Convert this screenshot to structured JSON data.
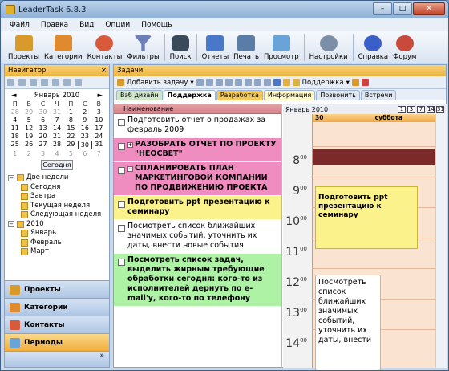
{
  "app": {
    "title": "LeaderTask 6.8.3"
  },
  "menu": [
    "Файл",
    "Правка",
    "Вид",
    "Опции",
    "Помощь"
  ],
  "toolbar": [
    {
      "label": "Проекты",
      "color": "#d89a2a"
    },
    {
      "label": "Категории",
      "color": "#e08a2f"
    },
    {
      "label": "Контакты",
      "color": "#d85a3a"
    },
    {
      "label": "Фильтры",
      "color": "#6d7fb8"
    },
    {
      "label": "Поиск",
      "color": "#3a4a5a"
    },
    {
      "label": "Отчеты",
      "color": "#4a78c8"
    },
    {
      "label": "Печать",
      "color": "#5a7da8"
    },
    {
      "label": "Просмотр",
      "color": "#6aa3d8"
    },
    {
      "label": "Настройки",
      "color": "#7d8fa8"
    },
    {
      "label": "Справка",
      "color": "#3a5fc8"
    },
    {
      "label": "Форум",
      "color": "#c84a3a"
    }
  ],
  "navigator": {
    "title": "Навигатор",
    "calendar": {
      "month": "Январь 2010",
      "weekdays": [
        "П",
        "В",
        "С",
        "Ч",
        "П",
        "С",
        "В"
      ],
      "days": [
        [
          "28",
          "29",
          "30",
          "31",
          "1",
          "2",
          "3"
        ],
        [
          "4",
          "5",
          "6",
          "7",
          "8",
          "9",
          "10"
        ],
        [
          "11",
          "12",
          "13",
          "14",
          "15",
          "16",
          "17"
        ],
        [
          "18",
          "19",
          "20",
          "21",
          "22",
          "23",
          "24"
        ],
        [
          "25",
          "26",
          "27",
          "28",
          "29",
          "30",
          "31"
        ],
        [
          "1",
          "2",
          "3",
          "4",
          "5",
          "6",
          "7"
        ]
      ],
      "today_label": "Сегодня"
    },
    "tree": {
      "g1": "Две недели",
      "g1items": [
        "Сегодня",
        "Завтра",
        "Текущая неделя",
        "Следующая неделя"
      ],
      "g2": "2010",
      "g2items": [
        "Январь",
        "Февраль",
        "Март"
      ]
    },
    "sections": [
      "Проекты",
      "Категории",
      "Контакты",
      "Периоды"
    ]
  },
  "tasks_panel": {
    "title": "Задачи",
    "add_label": "Добавить задачу",
    "podderzhka": "Поддержка",
    "tabs": [
      "Вэб дизайн",
      "Поддержка",
      "Разработка",
      "Информация",
      "Позвонить",
      "Встречи"
    ],
    "column_header": "Наименование",
    "rows": [
      {
        "text": "Подготовить отчет о продажах за февраль 2009",
        "style": "plain"
      },
      {
        "text": "РАЗОБРАТЬ ОТЧЕТ ПО ПРОЕКТУ \"НЕОСВЕТ\"",
        "style": "pink",
        "expander": "+"
      },
      {
        "text": "СПЛАНИРОВАТЬ ПЛАН МАРКЕТИНГОВОЙ КОМПАНИИ ПО ПРОДВИЖЕНИЮ ПРОЕКТА",
        "style": "pink",
        "expander": "−"
      },
      {
        "text": "Подготовить ppt презентацию к семинару",
        "style": "yellow"
      },
      {
        "text": "Посмотреть список ближайших значимых событий, уточнить их даты, внести новые события",
        "style": "plain"
      },
      {
        "text": "Посмотреть список задач, выделить жирным требующие обработки сегодня: кого-то из исполнителей дернуть по e-mail'у, кого-то по телефону",
        "style": "green"
      }
    ]
  },
  "calendar_view": {
    "month": "Январь 2010",
    "view_buttons": [
      "1",
      "3",
      "7",
      "14",
      "31"
    ],
    "day_number": "30",
    "day_name": "суббота",
    "hours": [
      "8",
      "9",
      "10",
      "11",
      "12",
      "13",
      "14"
    ],
    "appt1": "Подготовить ppt презентацию к семинару",
    "appt2": "Посмотреть список ближайших значимых событий, уточнить их даты, внести"
  }
}
